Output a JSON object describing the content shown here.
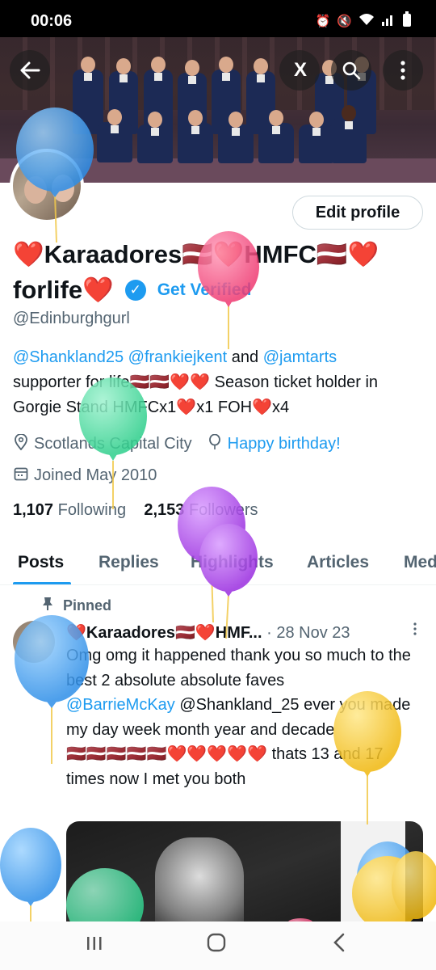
{
  "status_bar": {
    "time": "00:06",
    "icons": [
      "alarm-icon",
      "mute-icon",
      "wifi-icon",
      "signal-icon",
      "battery-icon"
    ]
  },
  "header": {
    "buttons": [
      "back-arrow-icon",
      "grok-icon",
      "search-icon",
      "more-vertical-icon"
    ],
    "grok_label": "X"
  },
  "profile": {
    "edit_label": "Edit profile",
    "name_line1": "❤️Karaadores🇱🇻❤️HMFC🇱🇻❤️",
    "name_line2": "forlife❤️",
    "get_verified": "Get Verified",
    "handle": "@Edinburghgurl",
    "bio": {
      "mention1": "@Shankland25",
      "mention2": "@frankiejkent",
      "and": "and",
      "mention3": "@jamtarts",
      "rest": "supporter for life🇱🇻🇱🇻❤️❤️  Season ticket holder in Gorgie Stand  HMFCx1❤️x1 FOH❤️x4"
    },
    "location": "Scotlands Capital City",
    "birthday": "Happy birthday!",
    "joined": "Joined May 2010",
    "following_count": "1,107",
    "following_label": "Following",
    "followers_count": "2,153",
    "followers_label": "Followers"
  },
  "tabs": [
    "Posts",
    "Replies",
    "Highlights",
    "Articles",
    "Media"
  ],
  "pinned_post": {
    "pinned_label": "Pinned",
    "author": "❤️Karaadores🇱🇻❤️HMF...",
    "date": "· 28 Nov 23",
    "text_line1": "Omg omg it happened thank you so much to the best 2 absolute absolute faves",
    "mention1": "@BarrieMcKay",
    "mention2_text": "@Shankland_25 ever you made my day week month year and decade",
    "text_line3": "🇱🇻🇱🇻🇱🇻🇱🇻🇱🇻❤️❤️❤️❤️❤️ thats 13 and 17 times now I met you both"
  },
  "nav_bar": {
    "buttons": [
      "recents-icon",
      "home-icon",
      "back-icon"
    ]
  },
  "colors": {
    "accent": "#1d9bf0",
    "text": "#0f1419",
    "muted": "#536471"
  }
}
